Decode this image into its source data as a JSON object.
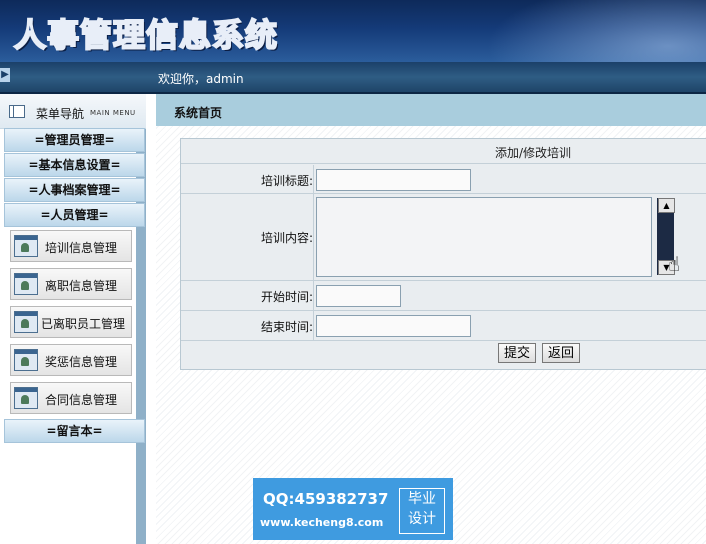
{
  "header": {
    "title": "人事管理信息系统"
  },
  "welcome": {
    "text": "欢迎你，admin"
  },
  "sidebar": {
    "menu_label": "菜单导航",
    "menu_sub": "MAIN MENU",
    "categories": {
      "admin": "=管理员管理=",
      "basic": "=基本信息设置=",
      "archive": "=人事档案管理=",
      "personnel": "=人员管理=",
      "guestbook": "=留言本="
    },
    "items": [
      {
        "label": "培训信息管理"
      },
      {
        "label": "离职信息管理"
      },
      {
        "label": "已离职员工管理"
      },
      {
        "label": "奖惩信息管理"
      },
      {
        "label": "合同信息管理"
      }
    ]
  },
  "main": {
    "breadcrumb": "系统首页",
    "form": {
      "title": "添加/修改培训",
      "fields": {
        "title_label": "培训标题:",
        "title_value": "",
        "content_label": "培训内容:",
        "content_value": "",
        "start_label": "开始时间:",
        "start_value": "",
        "end_label": "结束时间:",
        "end_value": ""
      },
      "submit_label": "提交",
      "back_label": "返回"
    }
  },
  "watermark": {
    "qq": "QQ:459382737",
    "url": "www.kecheng8.com",
    "badge_line1": "毕业",
    "badge_line2": "设计"
  }
}
